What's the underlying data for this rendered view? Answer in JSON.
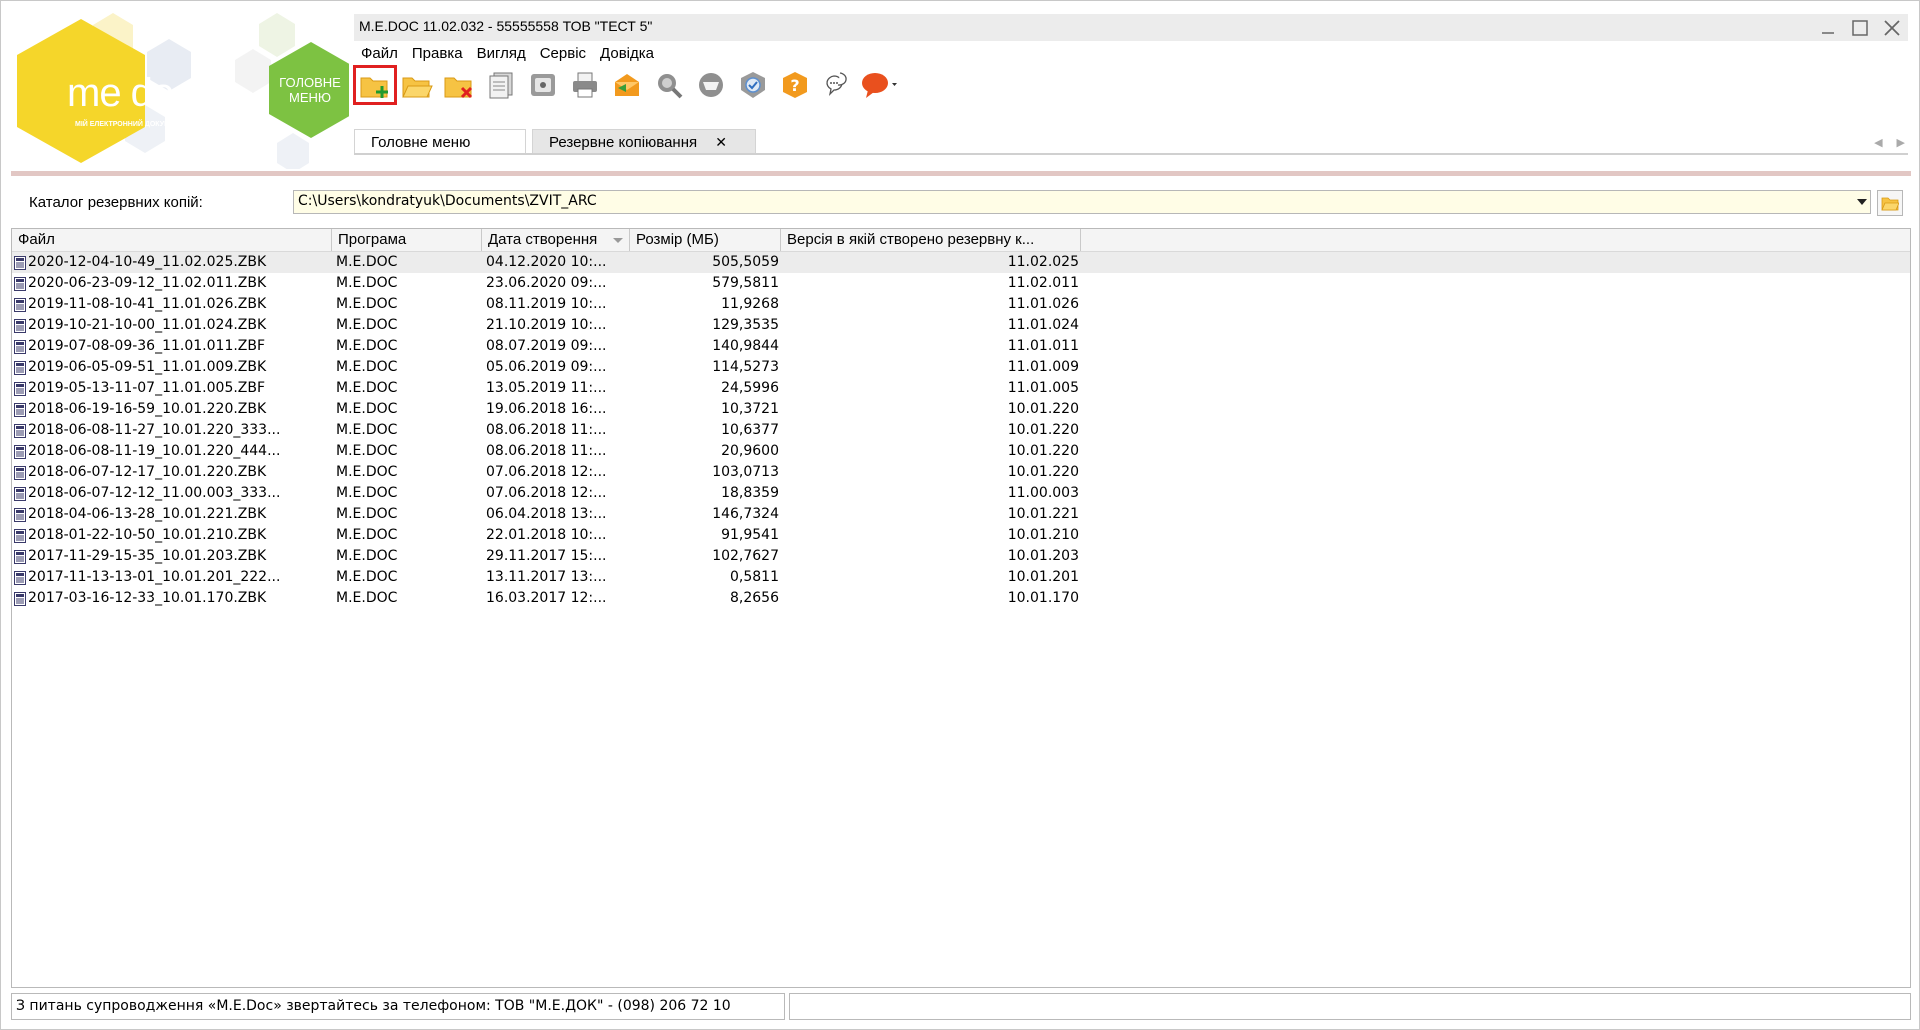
{
  "window": {
    "title": "M.E.DOC 11.02.032  - 55555558 ТОВ \"ТЕСТ 5\""
  },
  "logo": {
    "brand": "me doc",
    "subtitle": "МІЙ ЕЛЕКТРОННИЙ ДОКУМЕНТ",
    "home_button": "ГОЛОВНЕ МЕНЮ"
  },
  "menu": {
    "items": [
      "Файл",
      "Правка",
      "Вигляд",
      "Сервіс",
      "Довідка"
    ]
  },
  "toolbar": {
    "buttons": [
      {
        "icon": "folder-add-icon",
        "highlighted": true
      },
      {
        "icon": "folder-open-icon"
      },
      {
        "icon": "folder-delete-icon"
      },
      {
        "icon": "documents-icon"
      },
      {
        "icon": "archive-box-icon"
      },
      {
        "icon": "printer-icon"
      },
      {
        "icon": "envelope-send-icon"
      },
      {
        "icon": "search-key-icon"
      },
      {
        "icon": "inbox-tray-icon"
      },
      {
        "icon": "shield-check-icon"
      },
      {
        "icon": "help-icon"
      },
      {
        "icon": "support-chat-icon"
      },
      {
        "icon": "speech-bubble-icon"
      }
    ]
  },
  "tabs": {
    "items": [
      {
        "label": "Головне меню",
        "active": false
      },
      {
        "label": "Резервне копіювання",
        "active": true,
        "closable": true
      }
    ]
  },
  "catalog": {
    "label": "Каталог резервних копій:",
    "value": "C:\\Users\\kondratyuk\\Documents\\ZVIT_ARC"
  },
  "grid": {
    "columns": [
      "Файл",
      "Програма",
      "Дата створення",
      "Розмір (МБ)",
      "Версія в якій створено резервну к..."
    ],
    "rows": [
      {
        "file": "2020-12-04-10-49_11.02.025.ZBK",
        "program": "M.E.DOC",
        "date": "04.12.2020 10:...",
        "size": "505,5059",
        "version": "11.02.025"
      },
      {
        "file": "2020-06-23-09-12_11.02.011.ZBK",
        "program": "M.E.DOC",
        "date": "23.06.2020 09:...",
        "size": "579,5811",
        "version": "11.02.011"
      },
      {
        "file": "2019-11-08-10-41_11.01.026.ZBK",
        "program": "M.E.DOC",
        "date": "08.11.2019 10:...",
        "size": "11,9268",
        "version": "11.01.026"
      },
      {
        "file": "2019-10-21-10-00_11.01.024.ZBK",
        "program": "M.E.DOC",
        "date": "21.10.2019 10:...",
        "size": "129,3535",
        "version": "11.01.024"
      },
      {
        "file": "2019-07-08-09-36_11.01.011.ZBF",
        "program": "M.E.DOC",
        "date": "08.07.2019 09:...",
        "size": "140,9844",
        "version": "11.01.011"
      },
      {
        "file": "2019-06-05-09-51_11.01.009.ZBK",
        "program": "M.E.DOC",
        "date": "05.06.2019 09:...",
        "size": "114,5273",
        "version": "11.01.009"
      },
      {
        "file": "2019-05-13-11-07_11.01.005.ZBF",
        "program": "M.E.DOC",
        "date": "13.05.2019 11:...",
        "size": "24,5996",
        "version": "11.01.005"
      },
      {
        "file": "2018-06-19-16-59_10.01.220.ZBK",
        "program": "M.E.DOC",
        "date": "19.06.2018 16:...",
        "size": "10,3721",
        "version": "10.01.220"
      },
      {
        "file": "2018-06-08-11-27_10.01.220_333...",
        "program": "M.E.DOC",
        "date": "08.06.2018 11:...",
        "size": "10,6377",
        "version": "10.01.220"
      },
      {
        "file": "2018-06-08-11-19_10.01.220_444...",
        "program": "M.E.DOC",
        "date": "08.06.2018 11:...",
        "size": "20,9600",
        "version": "10.01.220"
      },
      {
        "file": "2018-06-07-12-17_10.01.220.ZBK",
        "program": "M.E.DOC",
        "date": "07.06.2018 12:...",
        "size": "103,0713",
        "version": "10.01.220"
      },
      {
        "file": "2018-06-07-12-12_11.00.003_333...",
        "program": "M.E.DOC",
        "date": "07.06.2018 12:...",
        "size": "18,8359",
        "version": "11.00.003"
      },
      {
        "file": "2018-04-06-13-28_10.01.221.ZBK",
        "program": "M.E.DOC",
        "date": "06.04.2018 13:...",
        "size": "146,7324",
        "version": "10.01.221"
      },
      {
        "file": "2018-01-22-10-50_10.01.210.ZBK",
        "program": "M.E.DOC",
        "date": "22.01.2018 10:...",
        "size": "91,9541",
        "version": "10.01.210"
      },
      {
        "file": "2017-11-29-15-35_10.01.203.ZBK",
        "program": "M.E.DOC",
        "date": "29.11.2017 15:...",
        "size": "102,7627",
        "version": "10.01.203"
      },
      {
        "file": "2017-11-13-13-01_10.01.201_222...",
        "program": "M.E.DOC",
        "date": "13.11.2017 13:...",
        "size": "0,5811",
        "version": "10.01.201"
      },
      {
        "file": "2017-03-16-12-33_10.01.170.ZBK",
        "program": "M.E.DOC",
        "date": "16.03.2017 12:...",
        "size": "8,2656",
        "version": "10.01.170"
      }
    ]
  },
  "status": {
    "message": "З питань супроводження «M.E.Doc» звертайтесь за телефоном: ТОВ \"М.Е.ДОК\" - (098) 206 72 10",
    "secondary": ""
  },
  "colors": {
    "brand_yellow": "#f5d62a",
    "brand_green": "#7dc242",
    "highlight_red": "#e02020",
    "pink_divider": "#e2c7c4",
    "catalog_bg": "#fffde6"
  }
}
